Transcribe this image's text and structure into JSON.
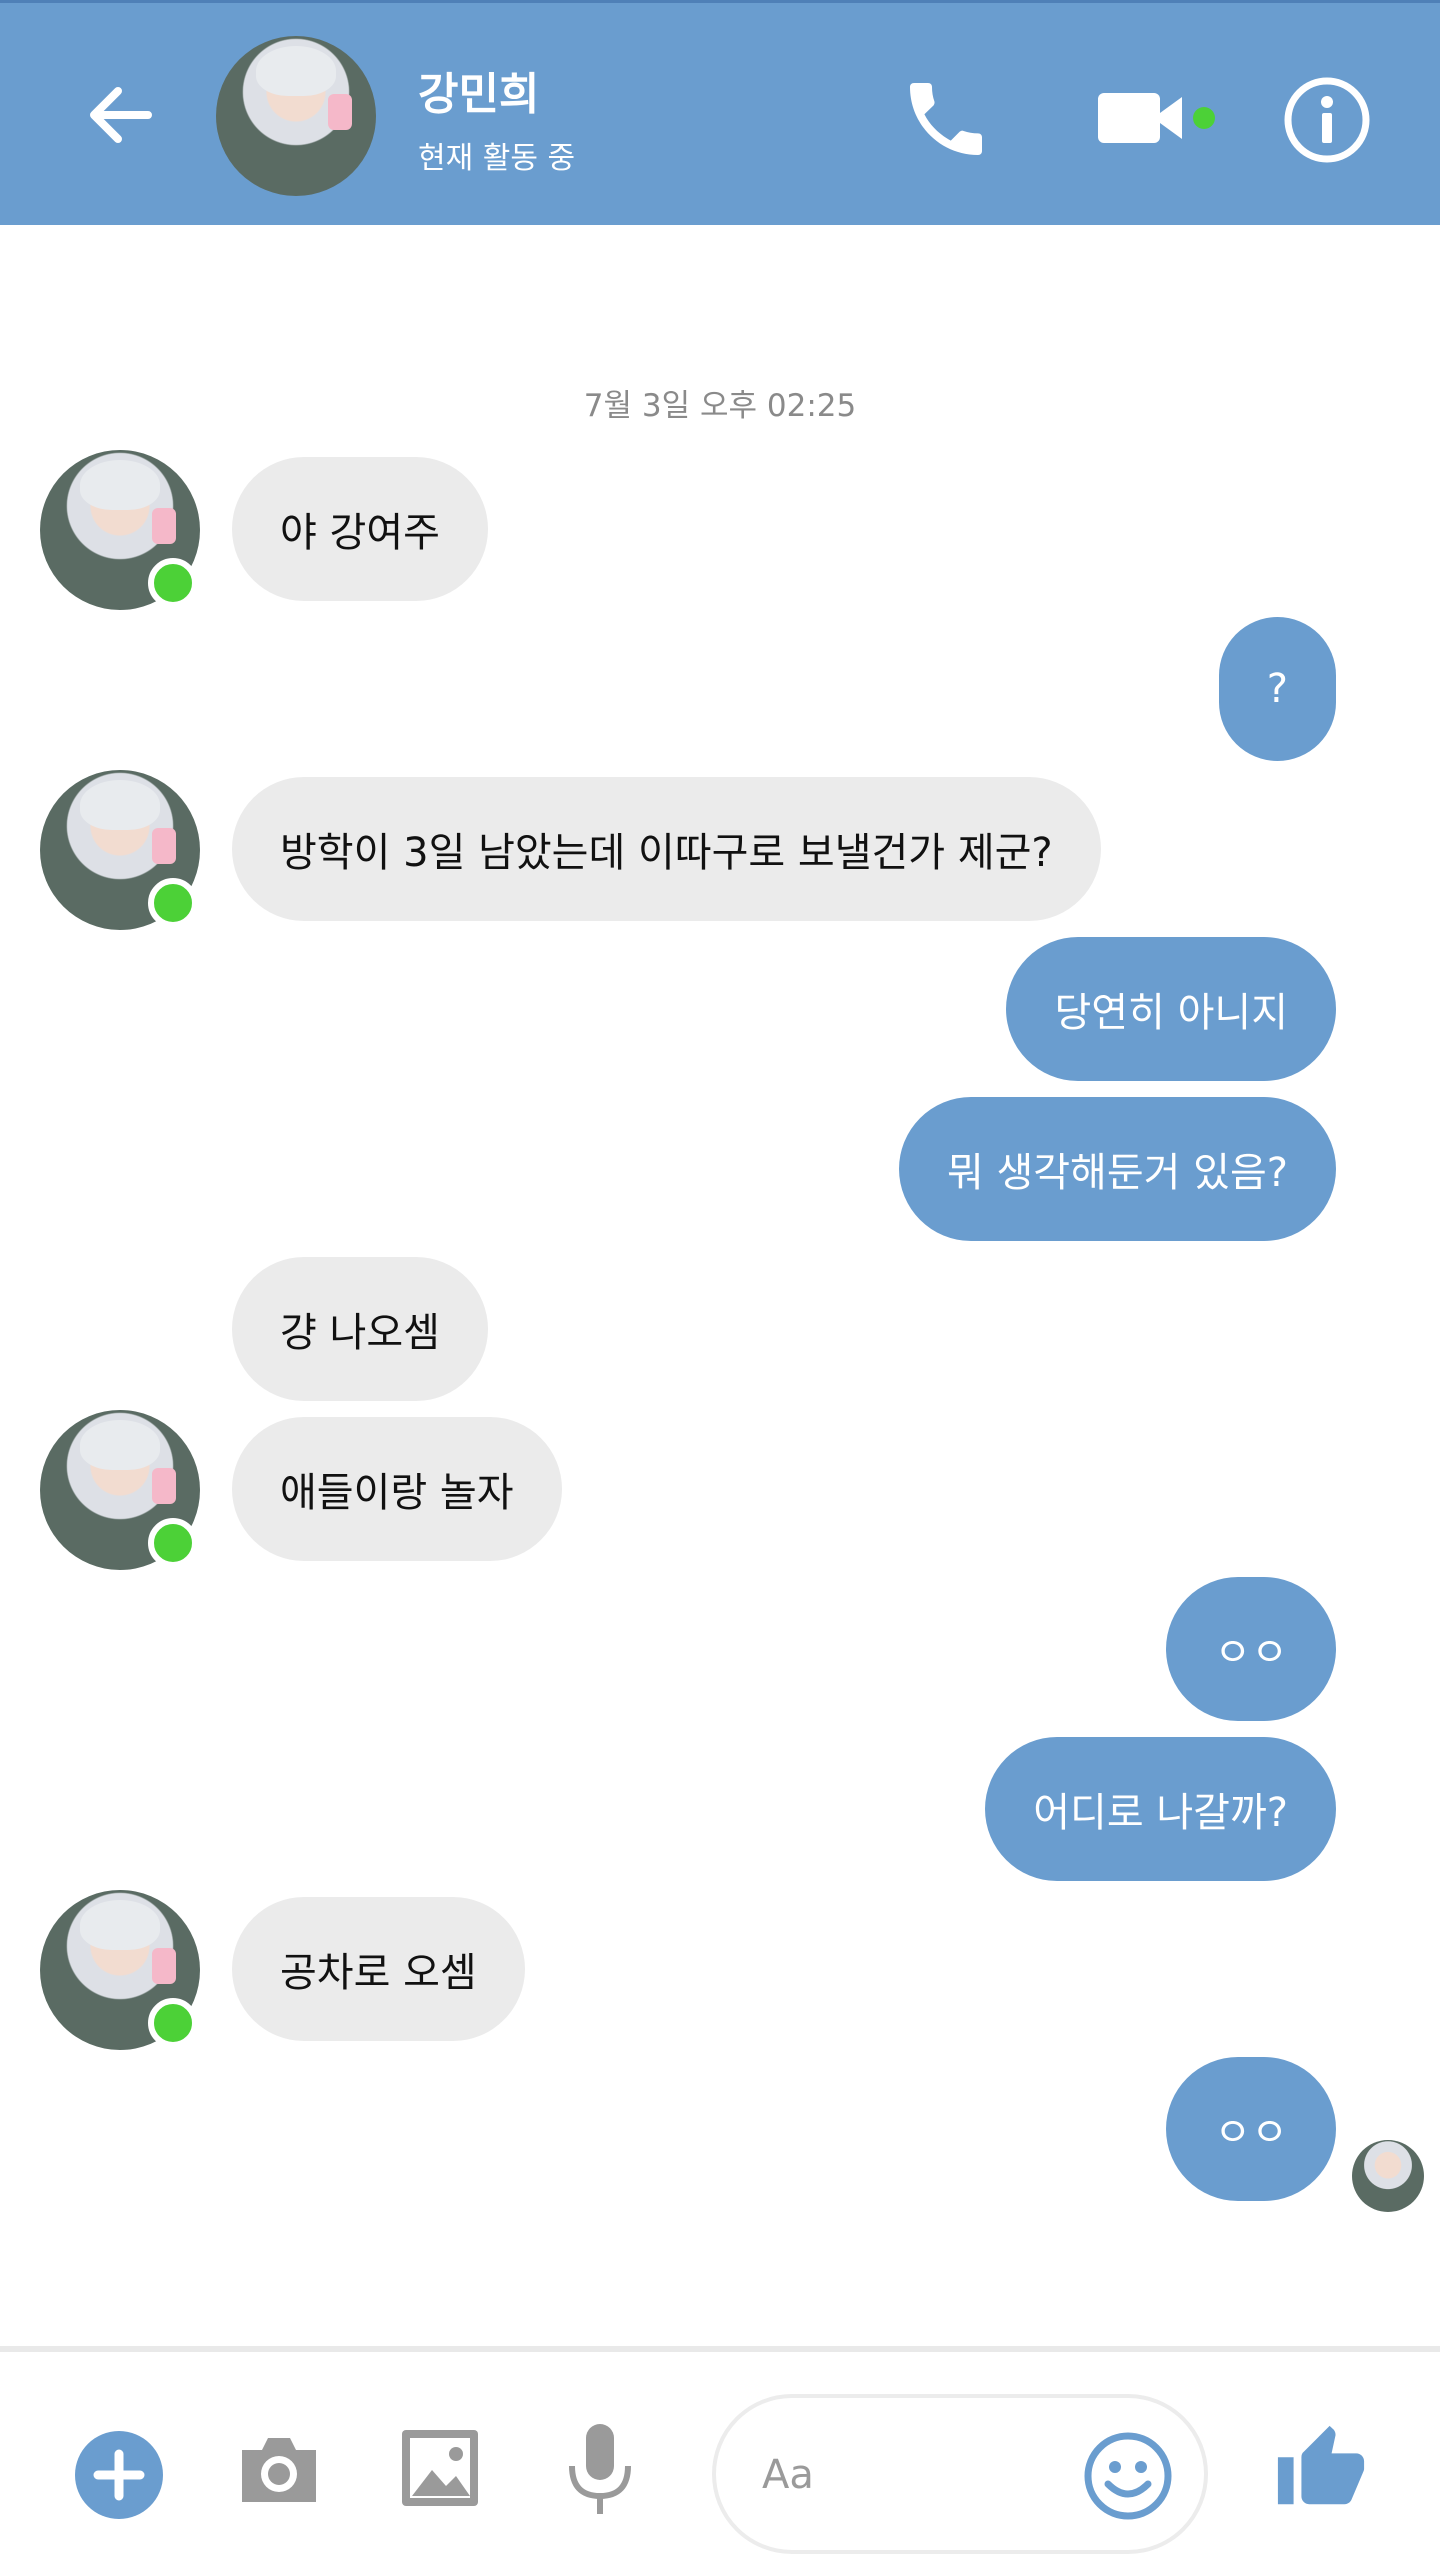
{
  "header": {
    "name": "강민희",
    "status": "현재 활동 중",
    "icons": {
      "back": "back-arrow-icon",
      "call": "phone-icon",
      "video": "video-camera-icon",
      "info": "info-icon"
    },
    "accent_color": "#6a9dcf"
  },
  "timestamp": "7월 3일 오후 02:25",
  "messages": [
    {
      "side": "in",
      "text": "야 강여주"
    },
    {
      "side": "out",
      "text": "?"
    },
    {
      "side": "in",
      "text": "방학이 3일 남았는데 이따구로 보낼건가 제군?"
    },
    {
      "side": "out",
      "text": "당연히 아니지"
    },
    {
      "side": "out",
      "text": "뭐 생각해둔거 있음?"
    },
    {
      "side": "in",
      "text": "걍 나오셈"
    },
    {
      "side": "in",
      "text": "애들이랑 놀자"
    },
    {
      "side": "out",
      "text": "ㅇㅇ"
    },
    {
      "side": "out",
      "text": "어디로 나갈까?"
    },
    {
      "side": "in",
      "text": "공차로 오셈"
    },
    {
      "side": "out",
      "text": "ㅇㅇ"
    }
  ],
  "footer": {
    "placeholder": "Aa",
    "icons": {
      "plus": "plus-icon",
      "camera": "camera-icon",
      "image": "image-icon",
      "mic": "microphone-icon",
      "emoji": "smiley-icon",
      "like": "thumbs-up-icon"
    }
  },
  "colors": {
    "outgoing": "#6a9dcf",
    "incoming": "#ebebeb",
    "online": "#4cd137"
  }
}
